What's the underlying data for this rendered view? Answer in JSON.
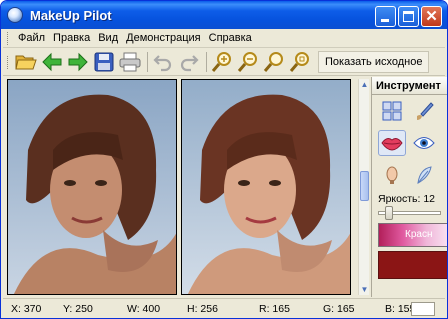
{
  "window": {
    "title": "MakeUp Pilot"
  },
  "menu": [
    "Файл",
    "Правка",
    "Вид",
    "Демонстрация",
    "Справка"
  ],
  "toolbar": {
    "show_original_label": "Показать исходное"
  },
  "panel": {
    "title": "Инструмент",
    "brightness_label": "Яркость: 12",
    "color_label": "Красн",
    "swatch_color": "#8b1515",
    "brightness_value": 12
  },
  "status": {
    "x": "X: 370",
    "y": "Y: 250",
    "w": "W: 400",
    "h": "H: 256",
    "r": "R: 165",
    "g": "G: 165",
    "b": "B: 155"
  },
  "colors": {
    "titlebar": "#0a5ce9",
    "chrome": "#ece9d8"
  }
}
